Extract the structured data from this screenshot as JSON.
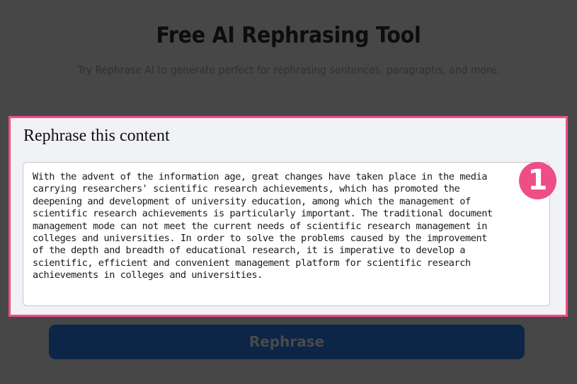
{
  "header": {
    "title": "Free AI Rephrasing Tool",
    "subtitle": "Try Rephrase AI to generate perfect for rephrasing sentences, paragraphs, and more."
  },
  "panel": {
    "heading": "Rephrase this content",
    "input_text": "With the advent of the information age, great changes have taken place in the media\ncarrying researchers' scientific research achievements, which has promoted the\ndeepening and development of university education, among which the management of\nscientific research achievements is particularly important. The traditional document\nmanagement mode can not meet the current needs of scientific research management in\ncolleges and universities. In order to solve the problems caused by the improvement\nof the depth and breadth of educational research, it is imperative to develop a\nscientific, efficient and convenient management platform for scientific research\nachievements in colleges and universities.",
    "step_badge": "1",
    "highlight_color": "#ef4d86"
  },
  "actions": {
    "rephrase_label": "Rephrase",
    "button_color": "#0d2647"
  }
}
